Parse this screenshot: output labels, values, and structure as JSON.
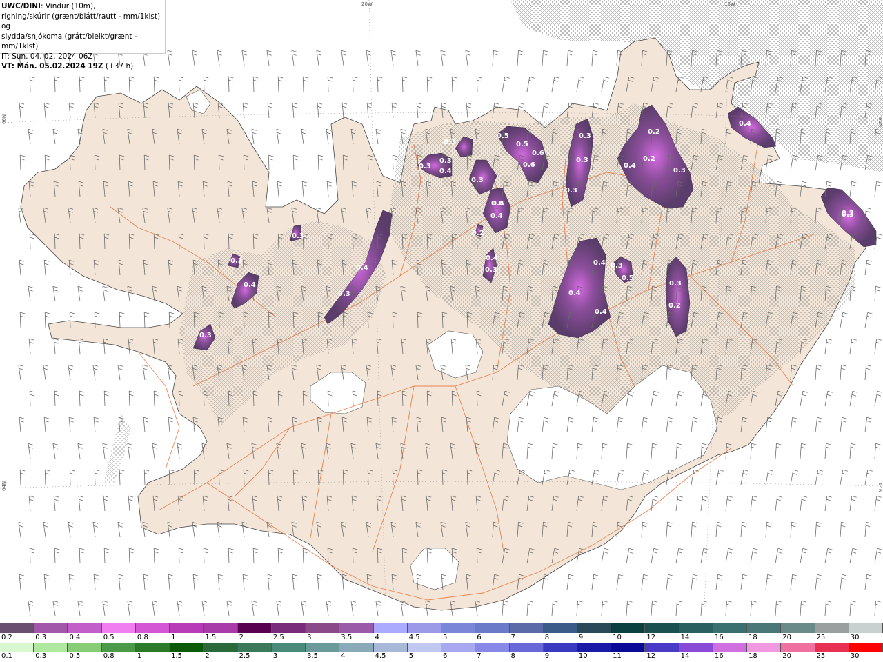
{
  "header": {
    "model": "UWC/DINI",
    "line1_rest": ": Vindur (10m),",
    "line2": "rigning/skúrir (grænt/blátt/rautt - mm/1klst) og",
    "line3": "slydda/snjókoma (grátt/bleikt/grænt - mm/1klst)",
    "it": "IT: Sun. 04. 02. 2024 06Z",
    "vt": "VT: Mán. 05.02.2024 19Z",
    "vt_rest": " (+37 h)"
  },
  "edge_labels": {
    "top_20w": "20W",
    "top_15w": "15W",
    "left_66n": "66N",
    "left_64n": "64N",
    "right_66n": "66N",
    "right_64n": "64N"
  },
  "precip_labels": [
    "0.3",
    "0.4",
    "0.3",
    "0.3",
    "0.4",
    "0.3",
    "0.3",
    "0.3",
    "0.4",
    "0.3",
    "0.3",
    "0.4",
    "0.4",
    "0.3",
    "0.4",
    "0.5",
    "0.5",
    "0.6",
    "0.6",
    "0.3",
    "0.3",
    "0.3",
    "0.4",
    "0.4",
    "0.4",
    "0.3",
    "0.5",
    "0.3",
    "0.2",
    "0.2",
    "0.2",
    "0.4",
    "0.3",
    "0.4",
    "0.3",
    "0.2",
    "0.2",
    "0.6"
  ],
  "colors": {
    "land": "#f3e6d8",
    "sea": "#ffffff",
    "glacier": "#ffffff",
    "roads": "#e8703a",
    "precip_dark": "#5a3d6a",
    "precip_mid": "#8a4e9a",
    "precip_light": "#c06ad0"
  },
  "scale_top": {
    "colors": [
      "#6b4f70",
      "#a258a8",
      "#c25fc8",
      "#f07ef0",
      "#d456d4",
      "#b83cb8",
      "#a83ca8",
      "#5a0050",
      "#7a2a7a",
      "#8a4a8a",
      "#9a5aa8",
      "#aaaaff",
      "#9a9ae8",
      "#7a86d8",
      "#6a7ac8",
      "#5a6aa8",
      "#3a5a88",
      "#2a4a5a",
      "#0a4040",
      "#1a5050",
      "#2a6060",
      "#3a7070",
      "#4a7878",
      "#6a8a8a",
      "#9aa0a0",
      "#c8d0d0"
    ],
    "labels": [
      "0.2",
      "0.3",
      "0.4",
      "0.5",
      "0.8",
      "1",
      "1.5",
      "2",
      "2.5",
      "3",
      "3.5",
      "4",
      "4.5",
      "5",
      "6",
      "7",
      "8",
      "9",
      "10",
      "12",
      "14",
      "16",
      "18",
      "20",
      "25",
      "30"
    ]
  },
  "scale_bottom": {
    "colors": [
      "#d8f8d0",
      "#b0e8a0",
      "#88cc78",
      "#4a9a4a",
      "#2a7a2a",
      "#0a5a0a",
      "#2a6a3a",
      "#3a7a5a",
      "#4a8a7a",
      "#6a9a9a",
      "#8aaaba",
      "#a8b8d8",
      "#c0c8f0",
      "#a8a8f0",
      "#8888e8",
      "#6868d8",
      "#3a3ac0",
      "#1a1aa8",
      "#0a0a98",
      "#4a3ac8",
      "#8a4ad8",
      "#d070e0",
      "#f098e0",
      "#f070a0",
      "#e83050",
      "#ff0000"
    ],
    "labels": [
      "0.1",
      "0.3",
      "0.5",
      "0.8",
      "1",
      "1.5",
      "2",
      "2.5",
      "3",
      "3.5",
      "4",
      "4.5",
      "5",
      "6",
      "7",
      "8",
      "9",
      "10",
      "11",
      "12",
      "14",
      "16",
      "18",
      "20",
      "25",
      "30"
    ]
  }
}
